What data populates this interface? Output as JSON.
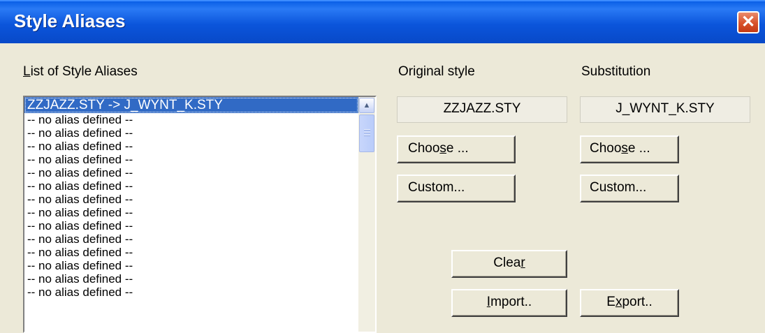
{
  "window": {
    "title": "Style Aliases",
    "close_symbol": "✕"
  },
  "list": {
    "label": "List of Style Aliases",
    "label_accel": "L",
    "items": [
      "ZZJAZZ.STY -> J_WYNT_K.STY",
      "-- no alias defined  --",
      "-- no alias defined  --",
      "-- no alias defined  --",
      "-- no alias defined  --",
      "-- no alias defined  --",
      "-- no alias defined  --",
      "-- no alias defined  --",
      "-- no alias defined  --",
      "-- no alias defined  --",
      "-- no alias defined  --",
      "-- no alias defined  --",
      "-- no alias defined  --",
      "-- no alias defined  --",
      "-- no alias defined  --"
    ],
    "selected_index": 0
  },
  "original": {
    "label": "Original style",
    "value": "ZZJAZZ.STY",
    "choose": {
      "pre": "Choo",
      "acc": "s",
      "post": "e ..."
    },
    "custom": "Custom..."
  },
  "substitution": {
    "label": "Substitution",
    "value": "J_WYNT_K.STY",
    "choose": {
      "pre": "Choo",
      "acc": "s",
      "post": "e ..."
    },
    "custom": "Custom..."
  },
  "actions": {
    "clear": {
      "pre": "Clea",
      "acc": "r",
      "post": ""
    },
    "import": {
      "pre": "",
      "acc": "I",
      "post": "mport.."
    },
    "export": {
      "pre": "E",
      "acc": "x",
      "post": "port.."
    }
  },
  "icons": {
    "scroll_up": "▲"
  }
}
